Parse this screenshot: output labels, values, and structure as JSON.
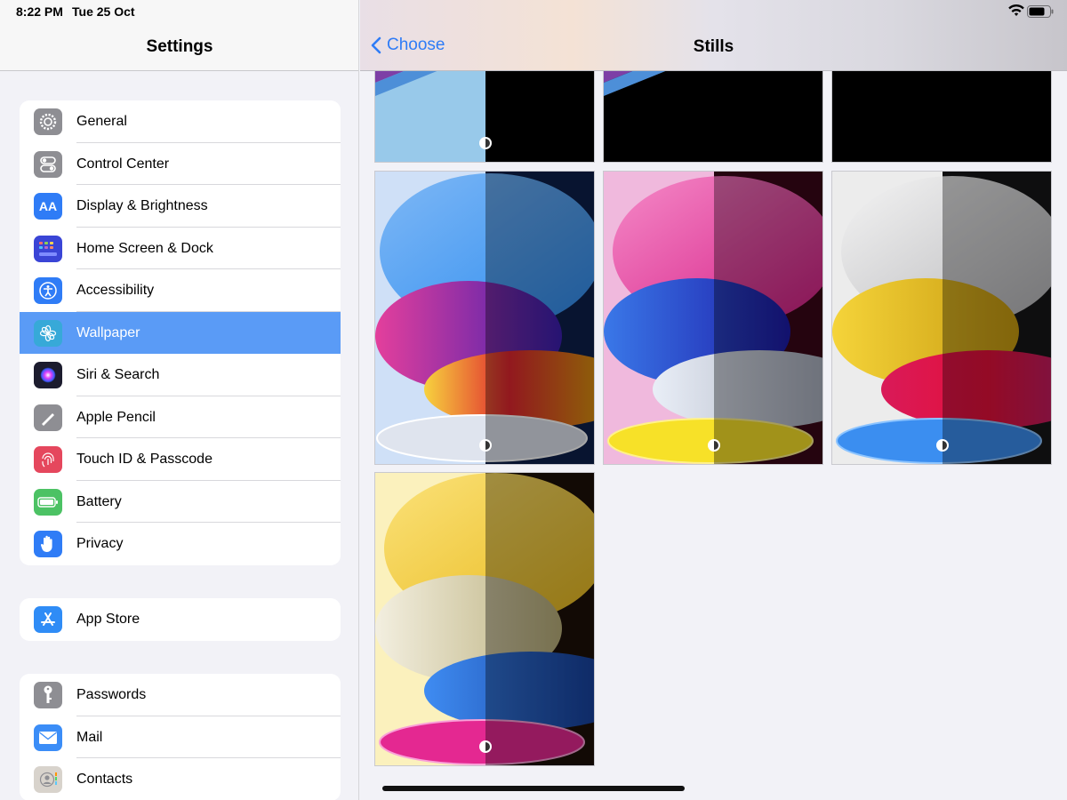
{
  "status": {
    "time": "8:22 PM",
    "date": "Tue 25 Oct"
  },
  "sidebar": {
    "title": "Settings",
    "groups": [
      {
        "items": [
          {
            "label": "General",
            "icon": "gear-icon",
            "color": "#8e8e93"
          },
          {
            "label": "Control Center",
            "icon": "toggle-icon",
            "color": "#8e8e93"
          },
          {
            "label": "Display & Brightness",
            "icon": "text-size-icon",
            "color": "#2f7cf6"
          },
          {
            "label": "Home Screen & Dock",
            "icon": "app-grid-icon",
            "color": "#3a45d6"
          },
          {
            "label": "Accessibility",
            "icon": "accessibility-icon",
            "color": "#2f7cf6"
          },
          {
            "label": "Wallpaper",
            "icon": "flower-icon",
            "color": "#37a9d8",
            "selected": true
          },
          {
            "label": "Siri & Search",
            "icon": "siri-icon",
            "color": "#222"
          },
          {
            "label": "Apple Pencil",
            "icon": "pencil-icon",
            "color": "#8e8e93"
          },
          {
            "label": "Touch ID & Passcode",
            "icon": "fingerprint-icon",
            "color": "#e5475d"
          },
          {
            "label": "Battery",
            "icon": "battery-icon",
            "color": "#4cc264"
          },
          {
            "label": "Privacy",
            "icon": "hand-icon",
            "color": "#2f7cf6"
          }
        ]
      },
      {
        "items": [
          {
            "label": "App Store",
            "icon": "app-store-icon",
            "color": "#2f8cf6"
          }
        ]
      },
      {
        "items": [
          {
            "label": "Passwords",
            "icon": "key-icon",
            "color": "#8e8e93"
          },
          {
            "label": "Mail",
            "icon": "mail-icon",
            "color": "#3b8df7"
          },
          {
            "label": "Contacts",
            "icon": "contacts-icon",
            "color": "#c9c4bd"
          }
        ]
      }
    ]
  },
  "content": {
    "back_label": "Choose",
    "title": "Stills",
    "wallpapers": [
      {
        "name": "blue",
        "light": "#a9cff2",
        "dark": "#000000"
      },
      {
        "name": "purple-blue",
        "light": "#000000",
        "dark": "#000000"
      },
      {
        "name": "black",
        "light": "#000000",
        "dark": "#000000"
      },
      {
        "name": "blue-magenta-yellow",
        "light": "#cfe0f7",
        "dark": "#0a1530"
      },
      {
        "name": "pink-blue-yellow",
        "light": "#f0b9dd",
        "dark": "#3a0718"
      },
      {
        "name": "gray-yellow-blue",
        "light": "#ececec",
        "dark": "#161618"
      },
      {
        "name": "yellow-blue-magenta",
        "light": "#fbf1bd",
        "dark": "#1c1008"
      }
    ]
  }
}
